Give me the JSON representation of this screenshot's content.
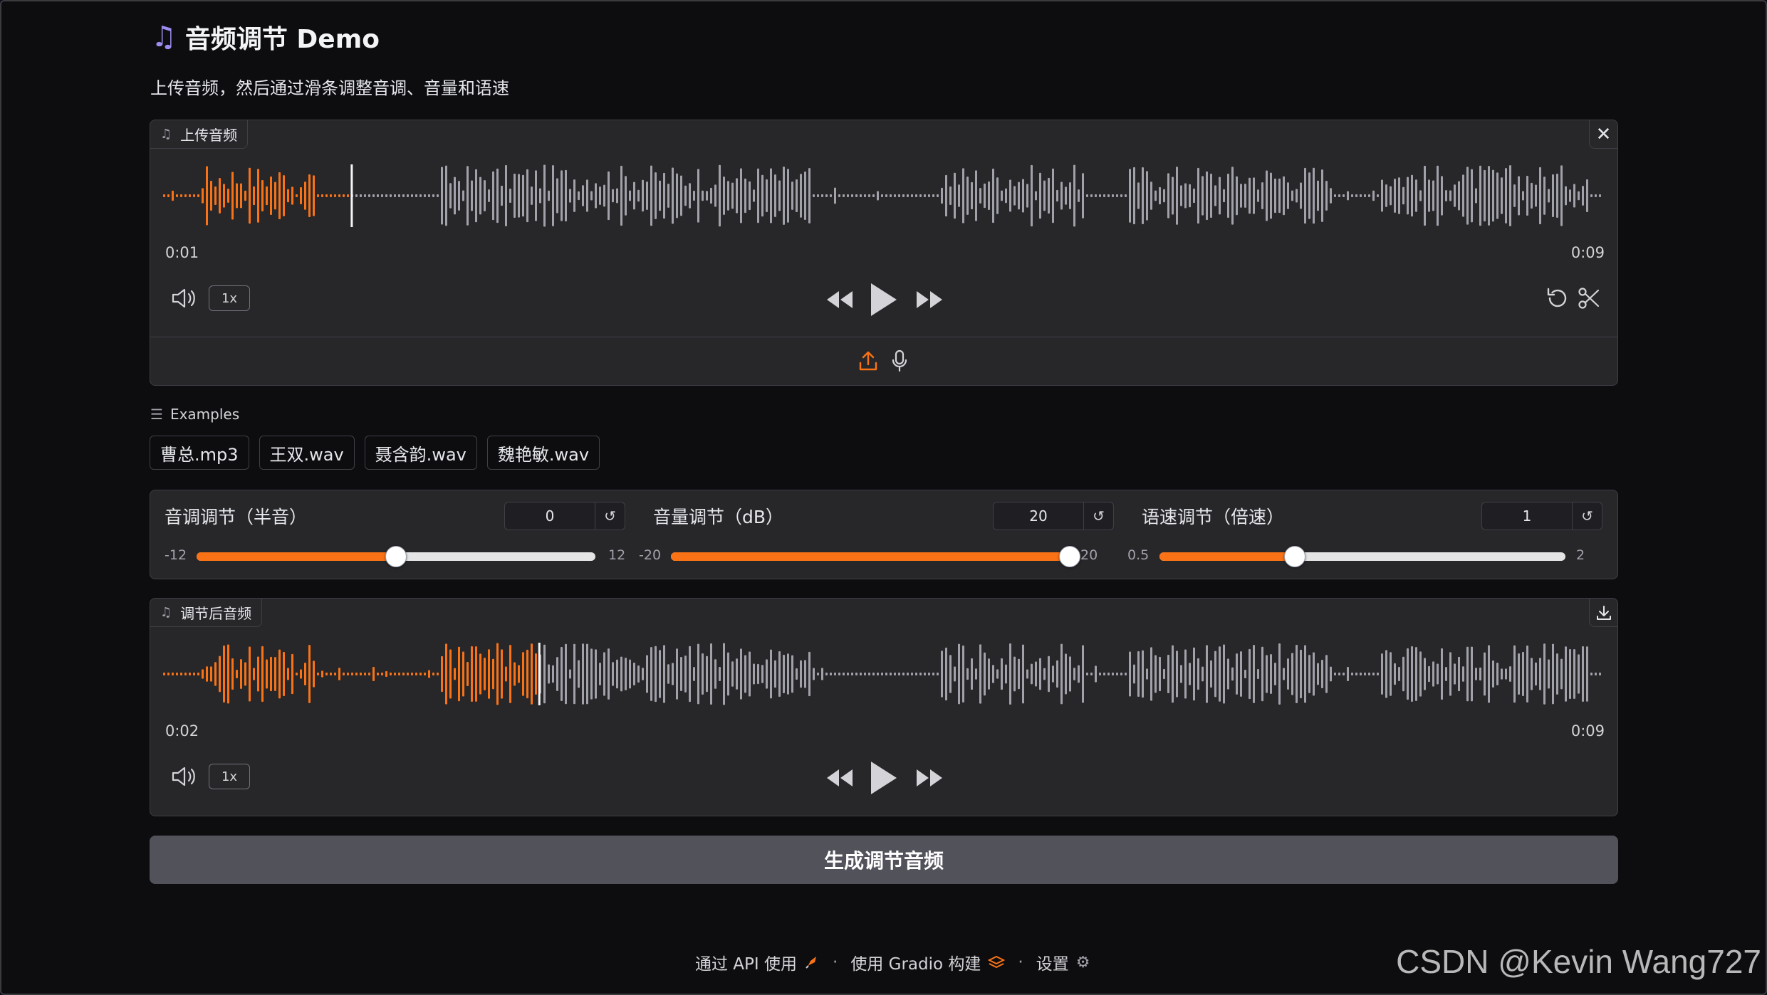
{
  "app": {
    "title_icon": "music-note-icon",
    "title": "音频调节 Demo",
    "subtitle": "上传音频，然后通过滑条调整音调、音量和语速"
  },
  "input_audio": {
    "label": "上传音频",
    "label_icon": "music-icon",
    "clear_icon": "close-icon",
    "current_time": "0:01",
    "duration": "0:09",
    "played_fraction": 0.13,
    "playback_rate": "1x",
    "controls": [
      "volume-icon",
      "rewind-icon",
      "play-icon",
      "fast-forward-icon",
      "undo-icon",
      "scissors-icon"
    ],
    "source_icons": [
      "upload-icon",
      "microphone-icon"
    ]
  },
  "examples": {
    "label": "Examples",
    "items": [
      "曹总.mp3",
      "王双.wav",
      "聂含韵.wav",
      "魏艳敏.wav"
    ]
  },
  "sliders": [
    {
      "label": "音调调节（半音）",
      "value": "0",
      "min": "-12",
      "max": "12",
      "fraction": 0.5
    },
    {
      "label": "音量调节（dB）",
      "value": "20",
      "min": "-20",
      "max": "20",
      "fraction": 1.0
    },
    {
      "label": "语速调节（倍速）",
      "value": "1",
      "min": "0.5",
      "max": "2",
      "fraction": 0.333
    }
  ],
  "output_audio": {
    "label": "调节后音频",
    "label_icon": "music-icon",
    "download_icon": "download-icon",
    "current_time": "0:02",
    "duration": "0:09",
    "played_fraction": 0.26,
    "playback_rate": "1x"
  },
  "generate_button": "生成调节音频",
  "footer": {
    "api": "通过 API 使用",
    "gradio": "使用 Gradio 构建",
    "settings": "设置",
    "separator": "·"
  },
  "watermark": "CSDN @Kevin Wang727",
  "colors": {
    "accent": "#f97316",
    "waveform_unplayed": "#a1a1aa",
    "panel": "#27272a",
    "background": "#0d0d10"
  }
}
